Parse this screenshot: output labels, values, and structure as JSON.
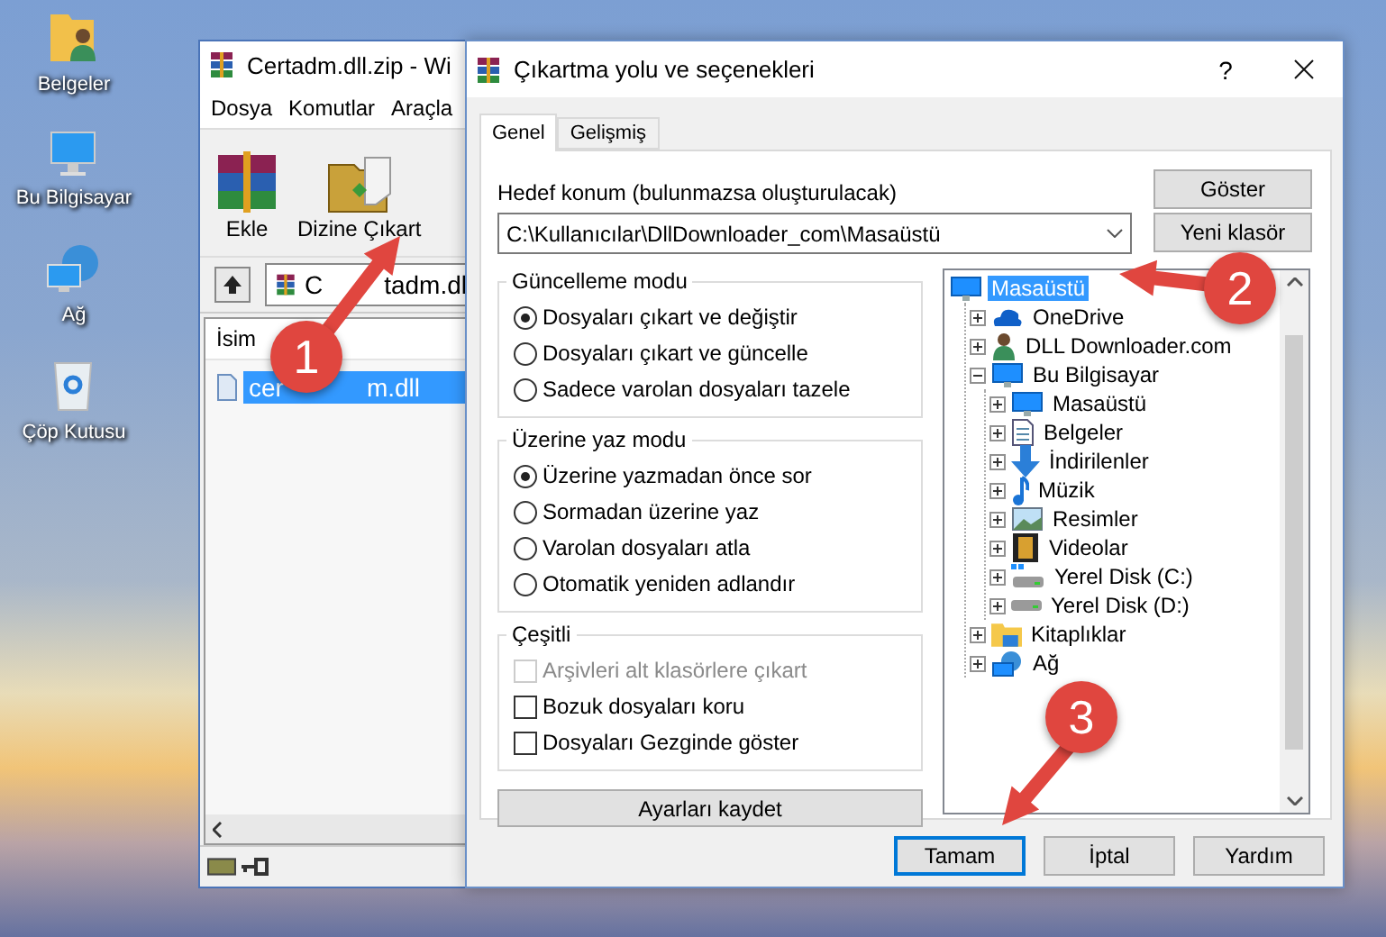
{
  "desktop_icons": [
    {
      "label": "Belgeler"
    },
    {
      "label": "Bu Bilgisayar"
    },
    {
      "label": "Ağ"
    },
    {
      "label": "Çöp Kutusu"
    }
  ],
  "archive_window": {
    "title": "Certadm.dll.zip - Wi",
    "menu": [
      "Dosya",
      "Komutlar",
      "Araçla"
    ],
    "toolbar": [
      {
        "label": "Ekle"
      },
      {
        "label": "Dizine Çıkart"
      }
    ],
    "path_parts": [
      "C",
      "tadm.dl"
    ],
    "column": "İsim",
    "files": [
      {
        "name_parts": [
          "cer",
          "m.dll"
        ],
        "selected": true
      }
    ]
  },
  "dialog": {
    "title": "Çıkartma yolu ve seçenekleri",
    "help": "?",
    "tabs": [
      {
        "label": "Genel",
        "selected": true
      },
      {
        "label": "Gelişmiş",
        "selected": false
      }
    ],
    "destination": {
      "label": "Hedef konum (bulunmazsa oluşturulacak)",
      "value": "C:\\Kullanıcılar\\DllDownloader_com\\Masaüstü"
    },
    "side_buttons": [
      "Göster",
      "Yeni klasör"
    ],
    "groups": [
      {
        "title": "Güncelleme modu",
        "options": [
          {
            "kind": "radio",
            "label": "Dosyaları çıkart ve değiştir",
            "selected": true
          },
          {
            "kind": "radio",
            "label": "Dosyaları çıkart ve güncelle",
            "selected": false
          },
          {
            "kind": "radio",
            "label": "Sadece varolan dosyaları tazele",
            "selected": false
          }
        ]
      },
      {
        "title": "Üzerine yaz modu",
        "options": [
          {
            "kind": "radio",
            "label": "Üzerine yazmadan önce sor",
            "selected": true
          },
          {
            "kind": "radio",
            "label": "Sormadan üzerine yaz",
            "selected": false
          },
          {
            "kind": "radio",
            "label": "Varolan dosyaları atla",
            "selected": false
          },
          {
            "kind": "radio",
            "label": "Otomatik yeniden adlandır",
            "selected": false
          }
        ]
      },
      {
        "title": "Çeşitli",
        "options": [
          {
            "kind": "checkbox",
            "label": "Arşivleri alt klasörlere çıkart",
            "checked": false,
            "disabled": true
          },
          {
            "kind": "checkbox",
            "label": "Bozuk dosyaları koru",
            "checked": false,
            "disabled": false
          },
          {
            "kind": "checkbox",
            "label": "Dosyaları Gezginde göster",
            "checked": false,
            "disabled": false
          }
        ]
      }
    ],
    "save_button": "Ayarları kaydet",
    "tree": [
      {
        "label": "Masaüstü",
        "selected": true,
        "children": [
          {
            "label": "OneDrive",
            "selected": false,
            "expanded": false
          },
          {
            "label": "DLL Downloader.com",
            "selected": false,
            "expanded": false
          },
          {
            "label": "Bu Bilgisayar",
            "selected": false,
            "expanded": true,
            "children": [
              {
                "label": "Masaüstü",
                "selected": false,
                "expanded": false
              },
              {
                "label": "Belgeler",
                "selected": false,
                "expanded": false
              },
              {
                "label": "İndirilenler",
                "selected": false,
                "expanded": false
              },
              {
                "label": "Müzik",
                "selected": false,
                "expanded": false
              },
              {
                "label": "Resimler",
                "selected": false,
                "expanded": false
              },
              {
                "label": "Videolar",
                "selected": false,
                "expanded": false
              },
              {
                "label": "Yerel Disk (C:)",
                "selected": false,
                "expanded": false
              },
              {
                "label": "Yerel Disk (D:)",
                "selected": false,
                "expanded": false
              }
            ]
          },
          {
            "label": "Kitaplıklar",
            "selected": false,
            "expanded": false
          },
          {
            "label": "Ağ",
            "selected": false,
            "expanded": false
          }
        ]
      }
    ],
    "footer_buttons": [
      {
        "label": "Tamam",
        "default": true
      },
      {
        "label": "İptal",
        "default": false
      },
      {
        "label": "Yardım",
        "default": false
      }
    ]
  },
  "annotations": [
    {
      "number": "1"
    },
    {
      "number": "2"
    },
    {
      "number": "3"
    }
  ]
}
